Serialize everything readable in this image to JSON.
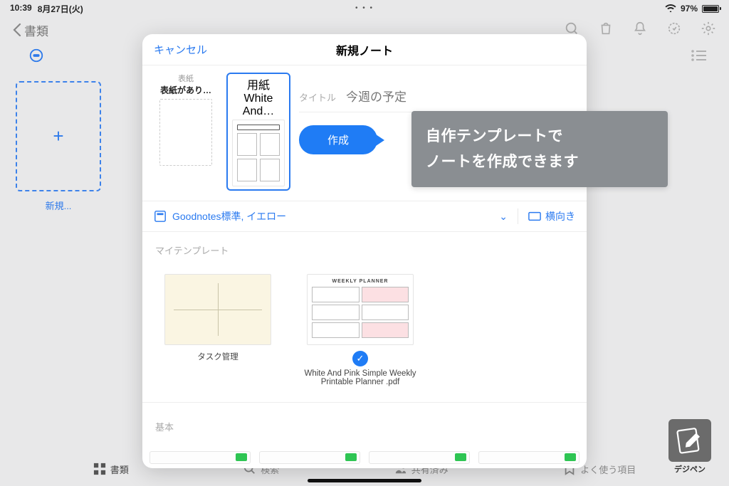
{
  "status": {
    "time": "10:39",
    "date": "8月27日(火)",
    "battery_pct": "97%"
  },
  "bg": {
    "back_label": "書類",
    "new_label": "新規...",
    "tabs": {
      "docs": "書類",
      "search": "検索",
      "shared": "共有済み",
      "fav": "よく使う項目"
    }
  },
  "modal": {
    "cancel": "キャンセル",
    "title": "新規ノート",
    "cover": {
      "label": "表紙",
      "name": "表紙があり…"
    },
    "paper": {
      "label": "用紙",
      "name": "White And…"
    },
    "title_field": {
      "label": "タイトル",
      "value": "今週の予定"
    },
    "create": "作成",
    "selector": {
      "style": "Goodnotes標準, イエロー",
      "orientation": "横向き"
    },
    "section_my": "マイテンプレート",
    "tpl1_name": "タスク管理",
    "tpl2_name": "White And Pink Simple Weekly Printable  Planner .pdf",
    "tpl2_thumb_title": "WEEKLY PLANNER",
    "section_basic": "基本"
  },
  "annotation": {
    "line1": "自作テンプレートで",
    "line2": "ノートを作成できます"
  },
  "brand": "デジペン"
}
